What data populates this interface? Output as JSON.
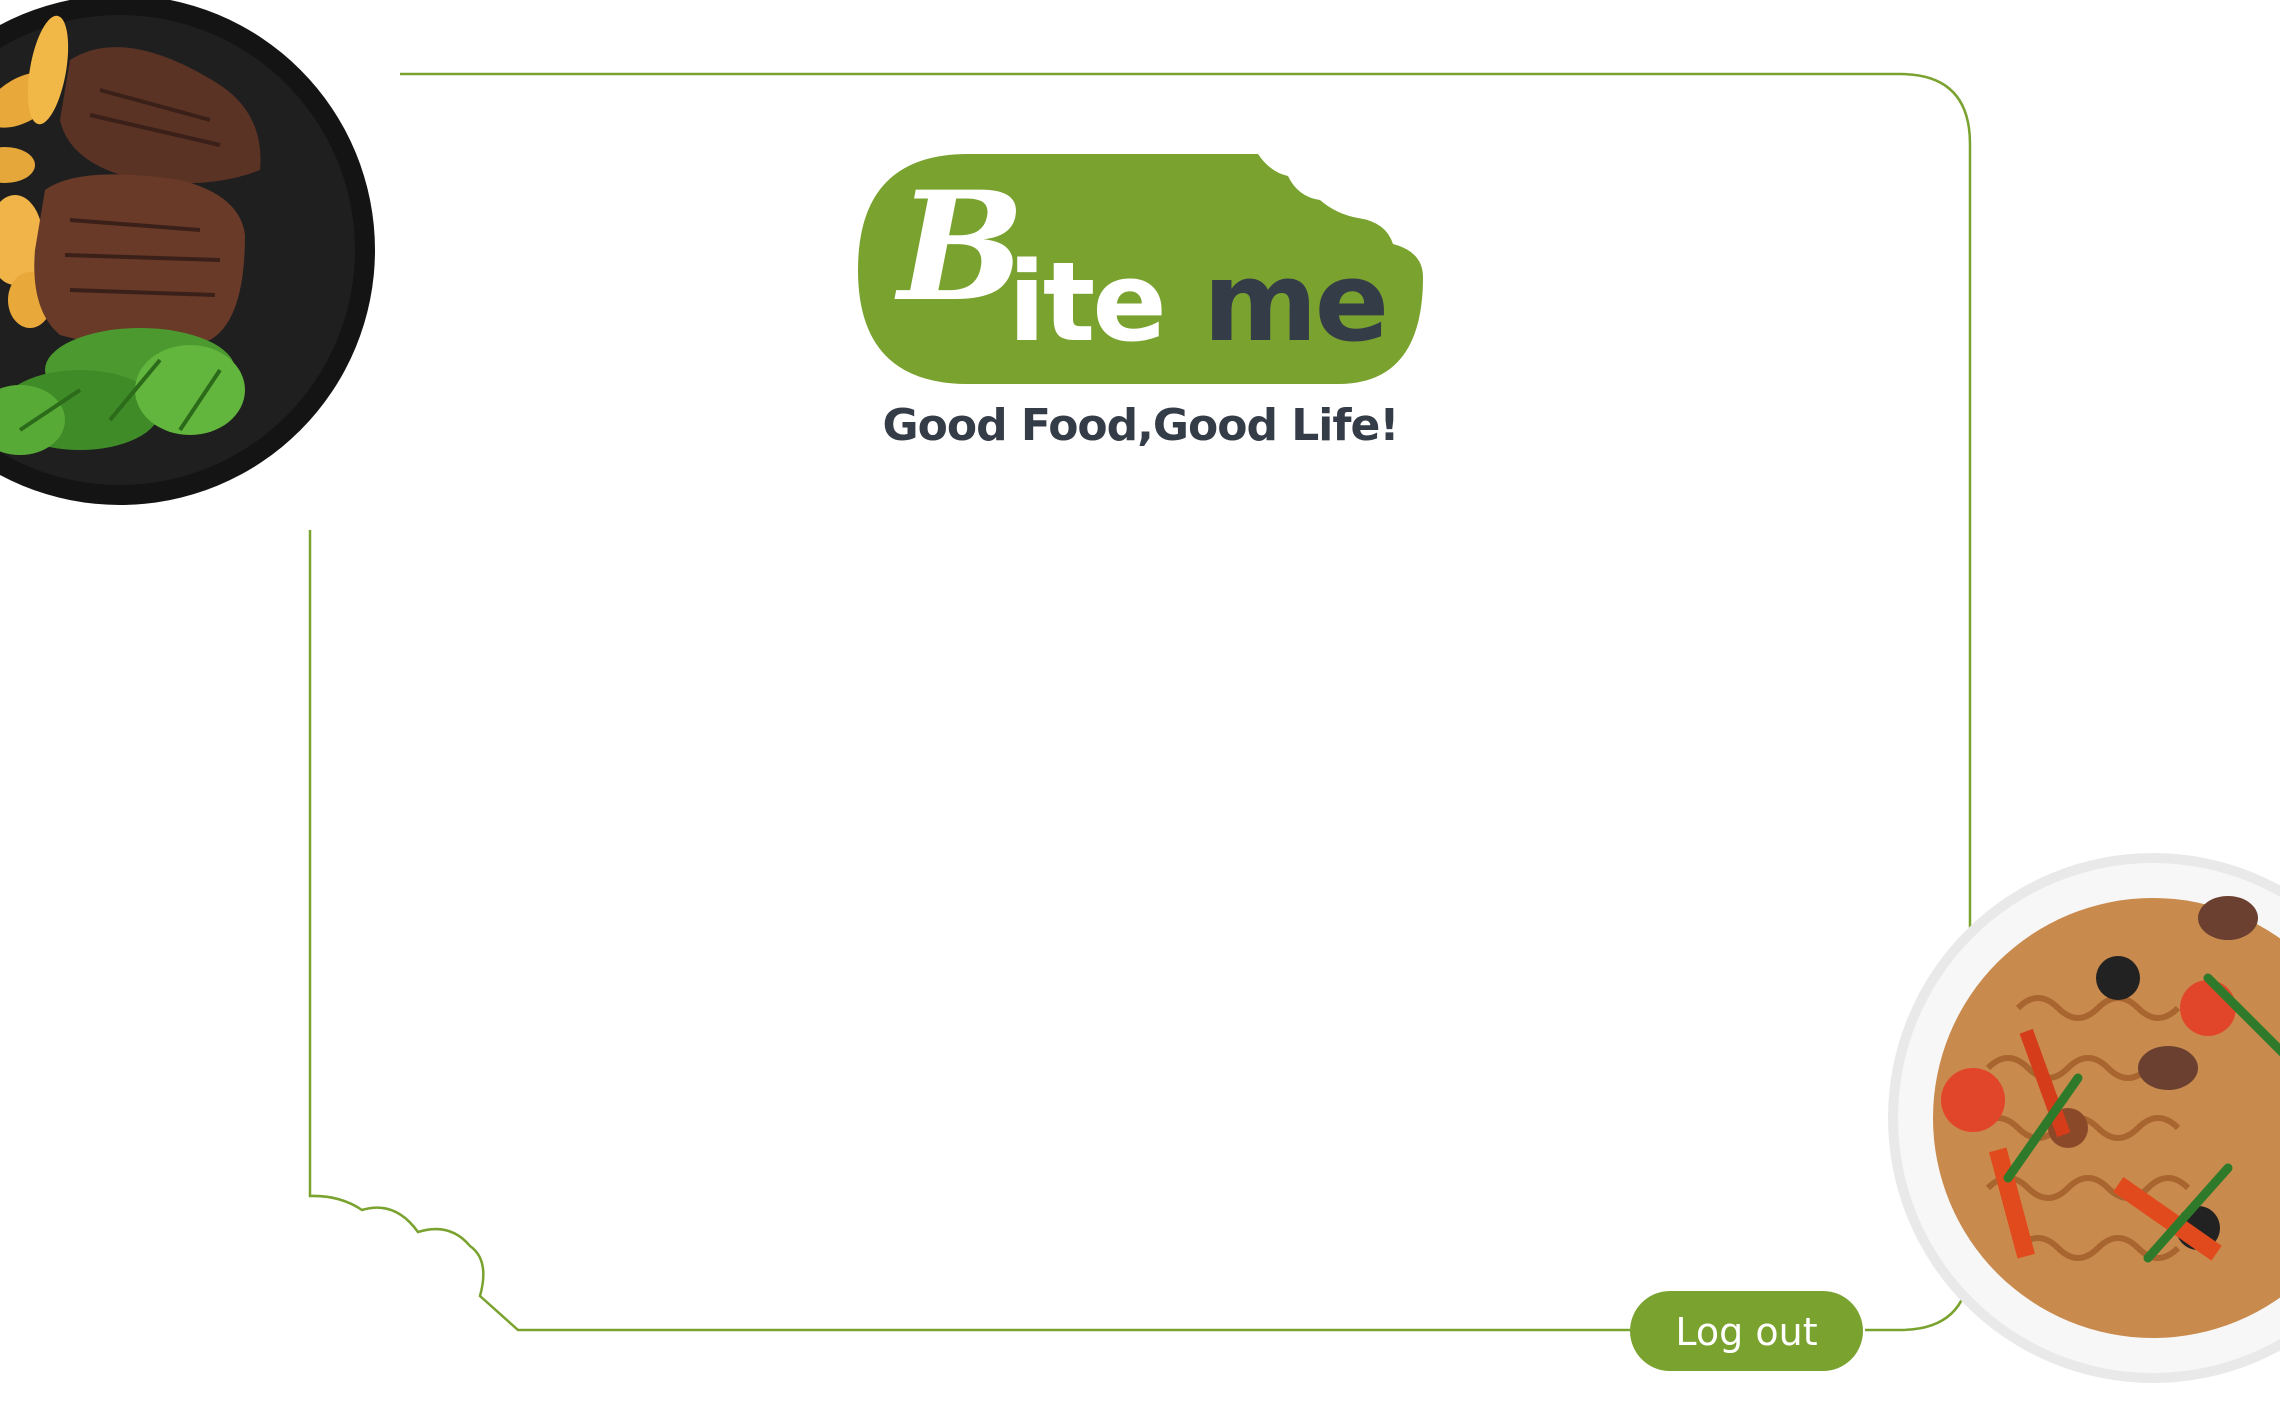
{
  "brand": {
    "logo_initial": "B",
    "logo_part_light": "ite",
    "logo_part_dark": "me",
    "tagline": "Good Food,Good Life!",
    "colors": {
      "accent_green": "#7aa22f",
      "dark_text": "#343c48",
      "background": "#ffffff"
    }
  },
  "images": {
    "top_left": "steak-plate-image",
    "bottom_right": "pasta-bowl-image"
  },
  "actions": {
    "logout_label": "Log out"
  }
}
